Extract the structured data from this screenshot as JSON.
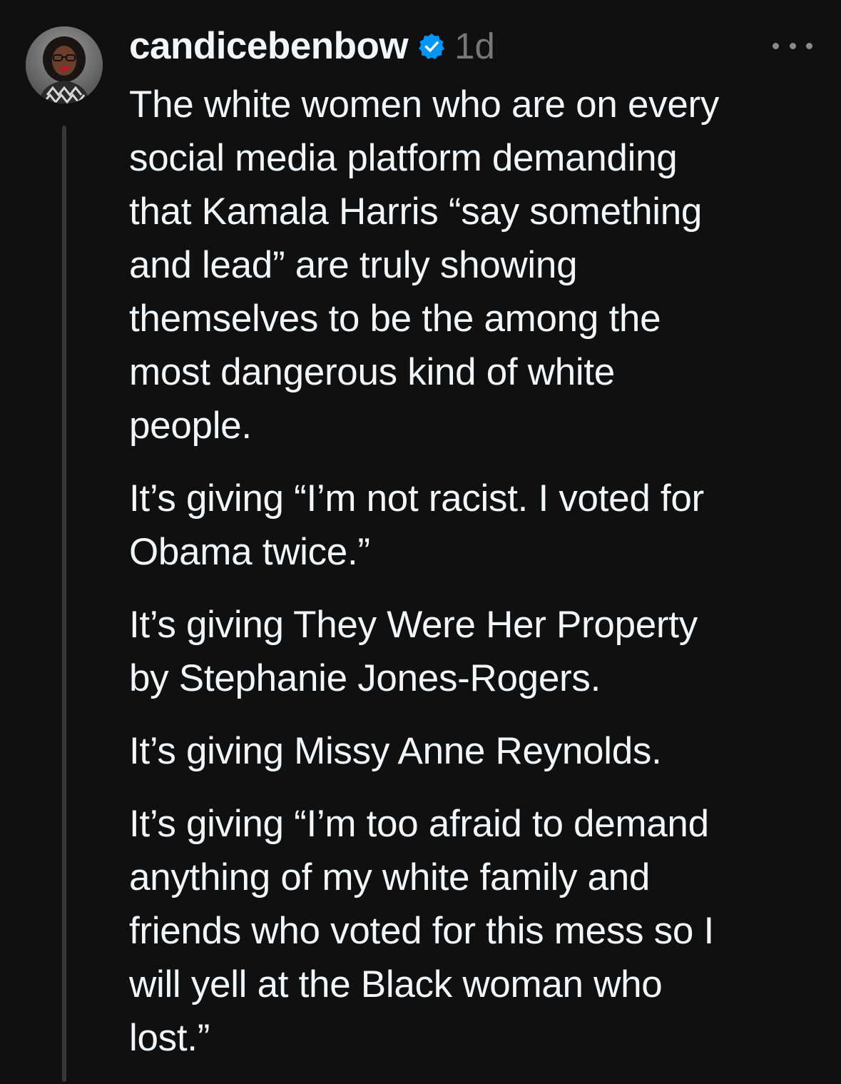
{
  "post": {
    "username": "candicebenbow",
    "timestamp": "1d",
    "paragraphs": [
      "The white women who are on every\nsocial media platform demanding\nthat Kamala Harris “say something\nand lead” are truly showing\nthemselves to be the among the\nmost dangerous kind of white\npeople.",
      "It’s giving “I’m not racist. I voted for\nObama twice.”",
      "It’s giving They Were Her Property\nby Stephanie Jones-Rogers.",
      "It’s giving Missy Anne Reynolds.",
      "It’s giving “I’m too afraid to demand\nanything of my white family and\nfriends who voted for this mess so I\nwill yell at the Black woman who\nlost.”"
    ]
  },
  "icons": {
    "verified": "verified-badge-icon",
    "more": "more-options-icon"
  },
  "colors": {
    "background": "#101010",
    "text": "#f3f5f7",
    "muted": "#777777",
    "verified": "#0095f6",
    "thread_line": "#373737"
  }
}
